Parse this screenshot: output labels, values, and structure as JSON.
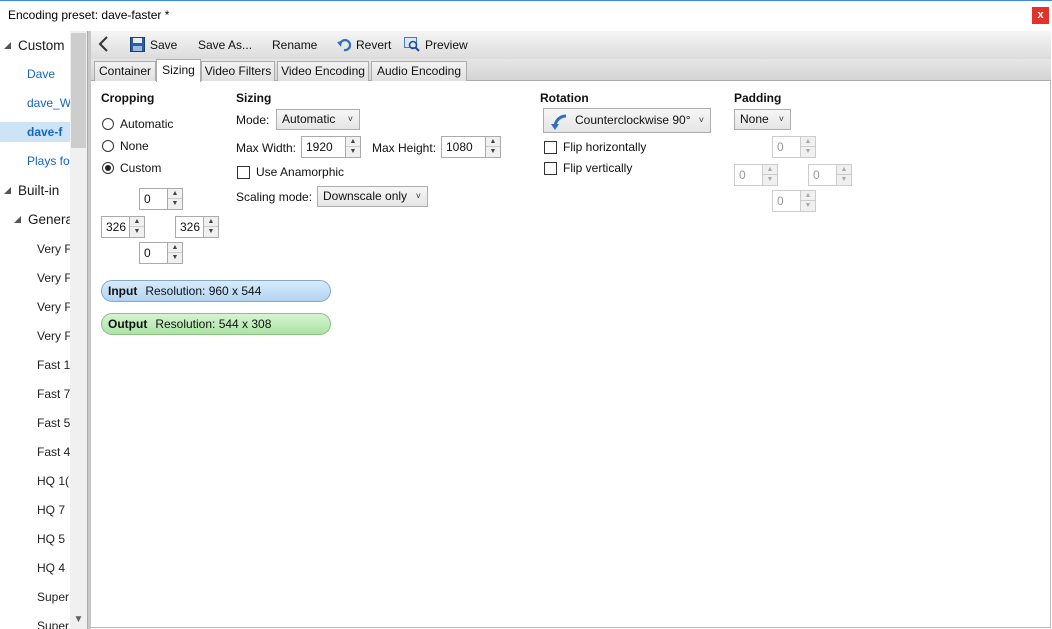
{
  "window": {
    "title": "Encoding preset: dave-faster *",
    "close_label": "x"
  },
  "sidebar": {
    "items": [
      {
        "label": "Custom"
      },
      {
        "label": "Dave"
      },
      {
        "label": "dave_W"
      },
      {
        "label": "dave-f"
      },
      {
        "label": "Plays fo"
      },
      {
        "label": "Built-in"
      },
      {
        "label": "Genera"
      },
      {
        "label": "Very F"
      },
      {
        "label": "Very F"
      },
      {
        "label": "Very F"
      },
      {
        "label": "Very F"
      },
      {
        "label": "Fast 1"
      },
      {
        "label": "Fast 7"
      },
      {
        "label": "Fast 5"
      },
      {
        "label": "Fast 4"
      },
      {
        "label": "HQ 1("
      },
      {
        "label": "HQ 7"
      },
      {
        "label": "HQ 5"
      },
      {
        "label": "HQ 4"
      },
      {
        "label": "Super"
      },
      {
        "label": "Super"
      }
    ]
  },
  "toolbar": {
    "save": "Save",
    "save_as": "Save As...",
    "rename": "Rename",
    "revert": "Revert",
    "preview": "Preview"
  },
  "tabs": [
    "Container",
    "Sizing",
    "Video Filters",
    "Video Encoding",
    "Audio Encoding"
  ],
  "active_tab": "Sizing",
  "cropping": {
    "header": "Cropping",
    "options": [
      "Automatic",
      "None",
      "Custom"
    ],
    "selected": "Custom",
    "top": "0",
    "left": "326",
    "right": "326",
    "bottom": "0"
  },
  "sizing": {
    "header": "Sizing",
    "mode_label": "Mode:",
    "mode_value": "Automatic",
    "max_width_label": "Max Width:",
    "max_width": "1920",
    "max_height_label": "Max Height:",
    "max_height": "1080",
    "anamorphic_label": "Use Anamorphic",
    "anamorphic_checked": false,
    "scaling_label": "Scaling mode:",
    "scaling_value": "Downscale only"
  },
  "rotation": {
    "header": "Rotation",
    "value": "Counterclockwise 90°",
    "flip_h_label": "Flip horizontally",
    "flip_v_label": "Flip vertically"
  },
  "padding": {
    "header": "Padding",
    "value": "None",
    "top": "0",
    "left": "0",
    "right": "0",
    "bottom": "0"
  },
  "input_info": {
    "label": "Input",
    "text": "Resolution: 960 x 544"
  },
  "output_info": {
    "label": "Output",
    "text": "Resolution: 544 x 308"
  },
  "colors": {
    "accent": "#1565c0",
    "close": "#e2322c",
    "input_pill": "#b1d3f1",
    "output_pill": "#ace4a4"
  }
}
